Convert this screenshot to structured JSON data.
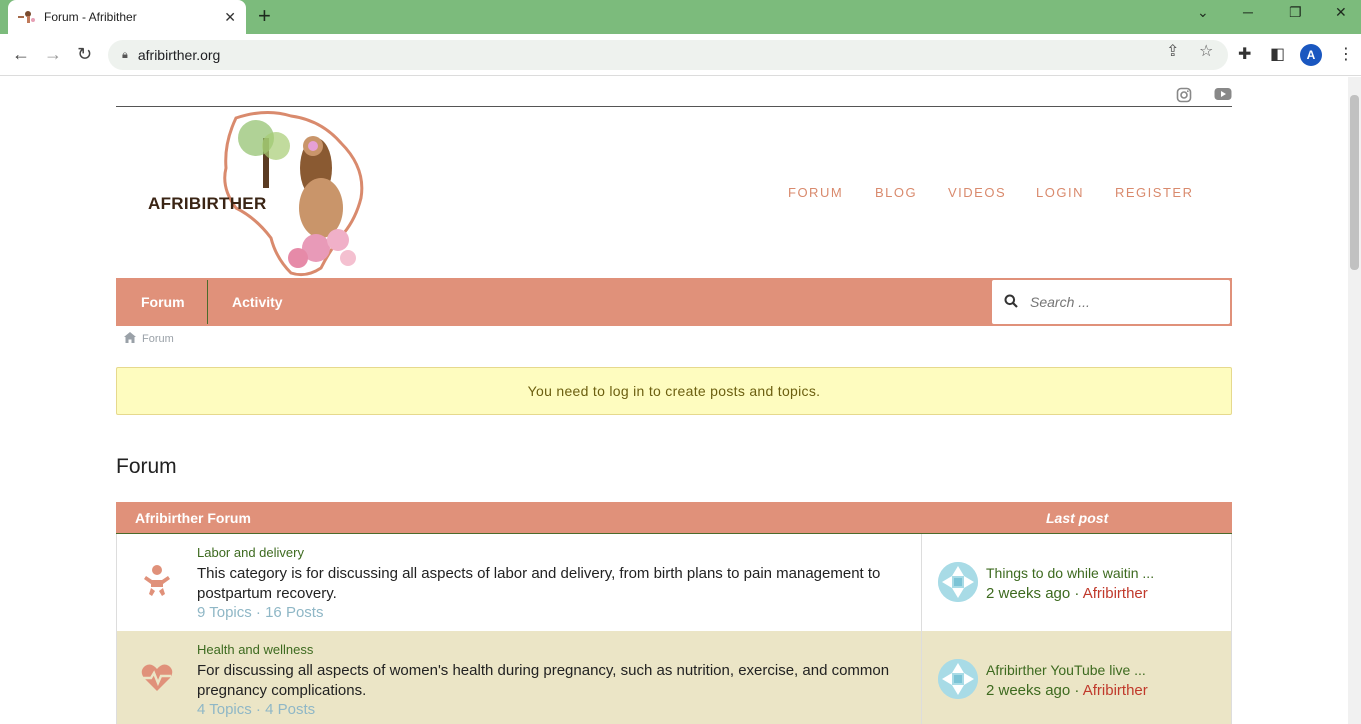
{
  "browser": {
    "tab_title": "Forum - Afribither",
    "tab_close": "✕",
    "new_tab": "+",
    "url": "afribirther.org",
    "profile_initial": "A"
  },
  "site": {
    "logo_text": "AFRIBIRTHER",
    "main_nav": [
      "FORUM",
      "BLOG",
      "VIDEOS",
      "LOGIN",
      "REGISTER"
    ],
    "sub_nav": [
      "Forum",
      "Activity"
    ],
    "search_placeholder": "Search ...",
    "breadcrumb": "Forum",
    "notice": "You need to log in to create posts and topics.",
    "page_title": "Forum"
  },
  "forum_table": {
    "header_left": "Afribirther Forum",
    "header_right": "Last post",
    "rows": [
      {
        "icon": "baby-icon",
        "name": "Labor and delivery",
        "description": "This category is for discussing all aspects of labor and delivery, from birth plans to pain management to postpartum recovery.",
        "meta": "9 Topics · 16 Posts",
        "last_post_title": "Things to do while waitin ...",
        "last_post_time": "2 weeks ago",
        "last_post_sep": " · ",
        "last_post_user": "Afribirther"
      },
      {
        "icon": "heartbeat-icon",
        "name": "Health and wellness",
        "description": "For discussing all aspects of women's health during pregnancy, such as nutrition, exercise, and common pregnancy complications.",
        "meta": "4 Topics · 4 Posts",
        "last_post_title": "Afribirther YouTube live ...",
        "last_post_time": "2 weeks ago",
        "last_post_sep": " · ",
        "last_post_user": "Afribirther"
      }
    ]
  },
  "colors": {
    "accent": "#e0917a",
    "nav_text": "#d98a6d",
    "link_green": "#3d6a1f",
    "user_red": "#c0392b",
    "notice_bg": "#fefcbf",
    "tabbar": "#7cbb7c"
  }
}
